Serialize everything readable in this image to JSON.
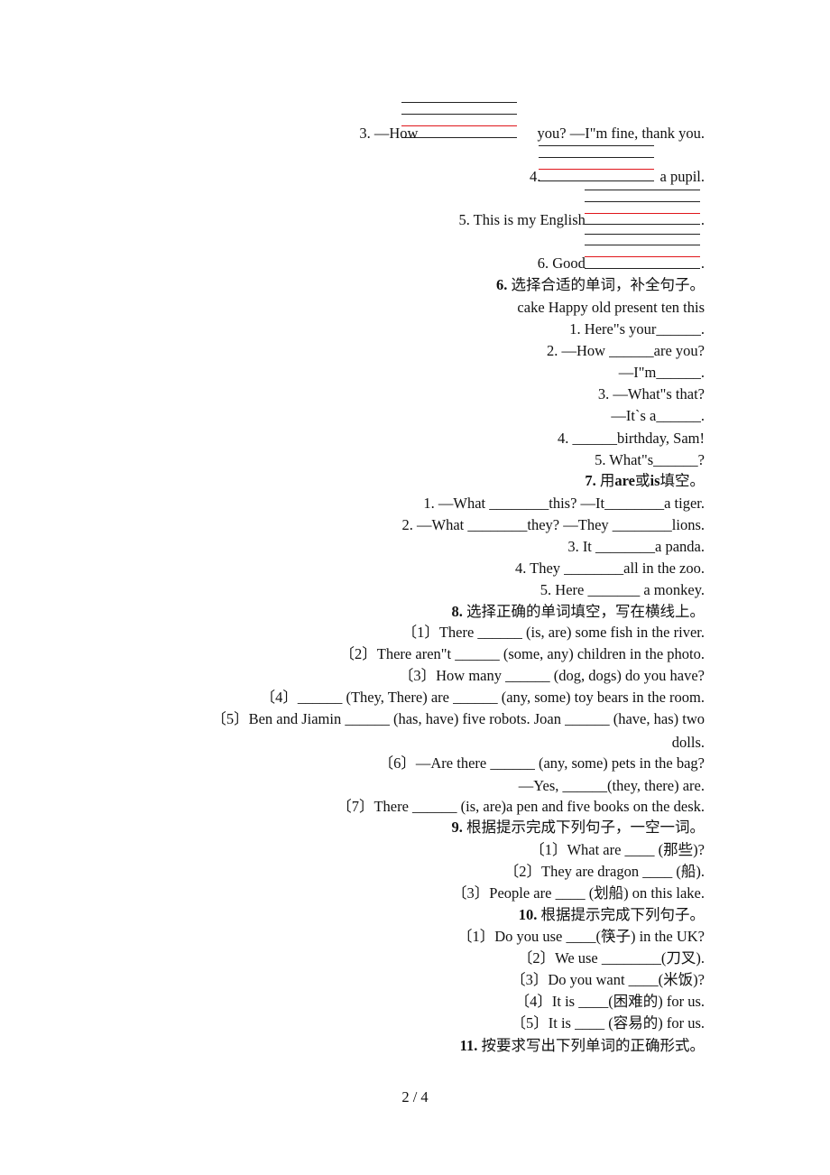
{
  "section5": {
    "items": [
      {
        "text": "3. —How ________________you? —I\"m fine, thank you.",
        "before": "3. —How ",
        "after": "you? —I\"m fine, thank you."
      },
      {
        "text": "4. ________________a pupil.",
        "before": "4. ",
        "after": "a pupil."
      },
      {
        "text": "5. This is my English________________.",
        "before": "5. This is my English",
        "after": "."
      },
      {
        "text": "6. Good________________.",
        "before": "6. Good",
        "after": "."
      }
    ]
  },
  "section6": {
    "number": "6.",
    "title": " 选择合适的单词，补全句子。",
    "word_bank": "cake Happy old present ten this",
    "items": [
      "1. Here\"s your______.",
      "2. —How ______are you?",
      "—I\"m______.",
      "3. —What\"s that?",
      "—It`s a______.",
      "4. ______birthday, Sam!",
      "5. What\"s______?"
    ]
  },
  "section7": {
    "number": "7.",
    "title_pre": " 用",
    "title_bold1": "are",
    "title_mid": "或",
    "title_bold2": "is",
    "title_post": "填空。",
    "items": [
      "1. —What ________this?  —It________a tiger.",
      "2. —What ________they? —They ________lions.",
      "3. It ________a panda.",
      "4. They ________all in the zoo.",
      "5. Here _______ a monkey."
    ]
  },
  "section8": {
    "number": "8.",
    "title": " 选择正确的单词填空，写在横线上。",
    "items": [
      "〔1〕There ______ (is, are) some fish in the river.",
      "〔2〕There aren\"t ______ (some, any) children in the photo.",
      "〔3〕How many ______ (dog, dogs) do you have?",
      "〔4〕______ (They, There) are ______ (any, some) toy bears in the room.",
      "〔5〕Ben and Jiamin ______ (has, have) five robots. Joan ______ (have, has) two",
      "dolls.",
      "〔6〕—Are there ______ (any, some) pets in the bag?",
      "—Yes, ______(they, there) are.",
      "〔7〕There ______ (is, are)a pen and five books on the desk."
    ]
  },
  "section9": {
    "number": "9.",
    "title": " 根据提示完成下列句子，一空一词。",
    "items": [
      "〔1〕What are ____ (那些)?",
      "〔2〕They are dragon ____ (船).",
      "〔3〕People are ____ (划船) on this lake."
    ]
  },
  "section10": {
    "number": "10.",
    "title": " 根据提示完成下列句子。",
    "items": [
      "〔1〕Do you use ____(筷子) in the UK?",
      "〔2〕We use ________(刀叉).",
      "〔3〕Do you want ____(米饭)?",
      "〔4〕It is ____(困难的) for us.",
      "〔5〕It is ____ (容易的) for us."
    ]
  },
  "section11": {
    "number": "11.",
    "title": " 按要求写出下列单词的正确形式。"
  },
  "footer": {
    "page_number": "2 / 4"
  },
  "colors": {
    "text": "#111111",
    "red_rule": "#e0161b"
  }
}
